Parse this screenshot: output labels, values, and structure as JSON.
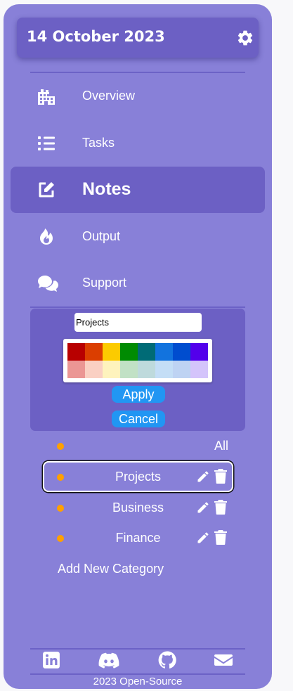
{
  "header": {
    "date": "14 October 2023",
    "settings_icon": "gear-icon"
  },
  "nav": {
    "items": [
      {
        "label": "Overview",
        "icon": "building-icon"
      },
      {
        "label": "Tasks",
        "icon": "list-icon"
      },
      {
        "label": "Notes",
        "icon": "edit-icon",
        "active": true
      },
      {
        "label": "Output",
        "icon": "fire-icon"
      },
      {
        "label": "Support",
        "icon": "chat-icon"
      }
    ]
  },
  "category_editor": {
    "name_value": "Projects",
    "colors_row1": [
      "#b80000",
      "#db3e00",
      "#fccb00",
      "#008b02",
      "#006b76",
      "#1273de",
      "#004dcf",
      "#5300eb"
    ],
    "colors_row2": [
      "#eb9694",
      "#fad0c3",
      "#fef3bd",
      "#c1e1c5",
      "#bedadc",
      "#c4def6",
      "#bed3f3",
      "#d4c4fb"
    ],
    "apply_label": "Apply",
    "cancel_label": "Cancel",
    "button_color": "#2196f3"
  },
  "categories": {
    "dot_color": "#ffa000",
    "items": [
      {
        "label": "All"
      },
      {
        "label": "Projects",
        "selected": true
      },
      {
        "label": "Business"
      },
      {
        "label": "Finance"
      }
    ],
    "add_label": "Add New Category"
  },
  "footer": {
    "social_icons": [
      "linkedin-icon",
      "discord-icon",
      "github-icon",
      "mail-icon"
    ],
    "text": "2023 Open-Source"
  },
  "colors": {
    "sidebar": "#8880d8",
    "accent": "#6c60c4"
  }
}
